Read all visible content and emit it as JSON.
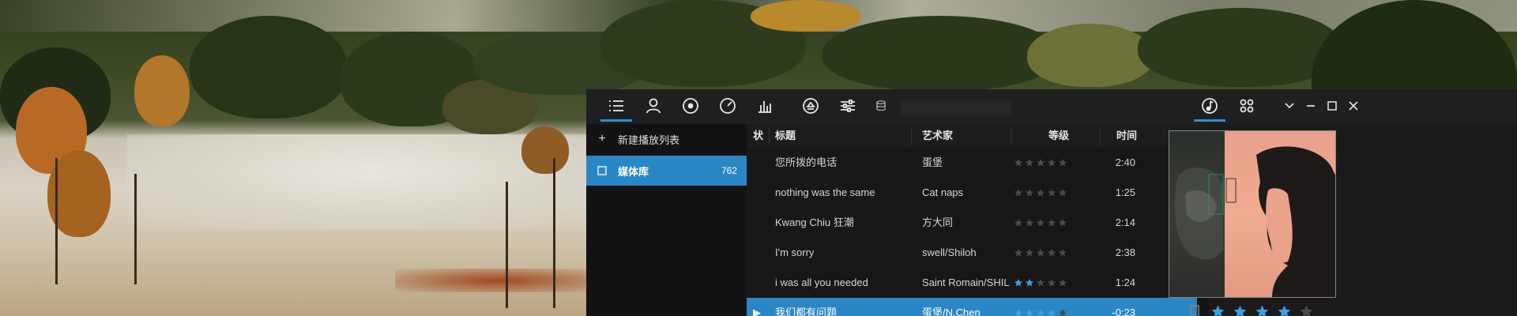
{
  "toolbar": {
    "icons": [
      "playlist-icon",
      "artist-icon",
      "album-icon",
      "genre-icon",
      "equalizer-bars-icon",
      "eject-icon",
      "settings-sliders-icon",
      "database-icon"
    ],
    "search_placeholder": "",
    "right_icons": [
      "music-note-icon",
      "apps-icon"
    ],
    "window_controls": [
      "chevron-down-icon",
      "minimize-icon",
      "maximize-icon",
      "close-icon"
    ]
  },
  "sidebar": {
    "new_playlist_label": "新建播放列表",
    "library_label": "媒体库",
    "library_count": "762"
  },
  "list": {
    "columns": {
      "status": "状",
      "title": "标题",
      "artist": "艺术家",
      "rating": "等级",
      "time": "时间"
    },
    "more_arrow": ">",
    "tracks": [
      {
        "title": "您所拨的电话",
        "artist": "蛋堡",
        "rating": 0,
        "time": "2:40",
        "playing": false
      },
      {
        "title": "nothing was the same",
        "artist": "Cat naps",
        "rating": 0,
        "time": "1:25",
        "playing": false
      },
      {
        "title": "Kwang Chiu 狂潮",
        "artist": "方大同",
        "rating": 0,
        "time": "2:14",
        "playing": false
      },
      {
        "title": "I'm sorry",
        "artist": "swell/Shiloh",
        "rating": 0,
        "time": "2:38",
        "playing": false
      },
      {
        "title": "i was all you needed",
        "artist": "Saint Romain/SHIL",
        "rating": 2,
        "time": "1:24",
        "playing": false
      },
      {
        "title": "我们都有问题",
        "artist": "蛋堡/N.Chen",
        "rating": 4,
        "time": "-0:23",
        "playing": true
      }
    ]
  },
  "now_playing": {
    "rating": 4,
    "rating_max": 5
  },
  "colors": {
    "accent": "#2a86c4",
    "star_on": "#3aa0e6",
    "star_off": "#4a4a4a"
  }
}
